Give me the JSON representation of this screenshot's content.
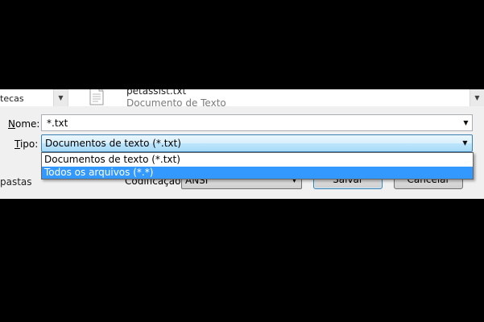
{
  "nav": {
    "item_label": "tecas"
  },
  "file_list": {
    "file_name": "petassist.txt",
    "file_type": "Documento de Texto"
  },
  "form": {
    "name_label": "Nome:",
    "name_value": "*.txt",
    "type_label": "Tipo:",
    "type_value": "Documentos de texto (*.txt)",
    "folders_toggle": "pastas",
    "encoding_label": "Codificação:",
    "encoding_value": "ANSI",
    "save_label": "Salvar",
    "cancel_label": "Cancelar"
  },
  "dropdown": {
    "options": [
      {
        "label": "Documentos de texto (*.txt)",
        "selected": false
      },
      {
        "label": "Todos os arquivos  (*.*)",
        "selected": true
      }
    ]
  },
  "icons": {
    "dropdown_arrow": "chevron-down-icon",
    "file": "text-file-icon"
  },
  "colors": {
    "selection": "#3399ff",
    "focus_border": "#3c7fb1",
    "dialog_background": "#f0f0f0",
    "outside": "#000000"
  }
}
